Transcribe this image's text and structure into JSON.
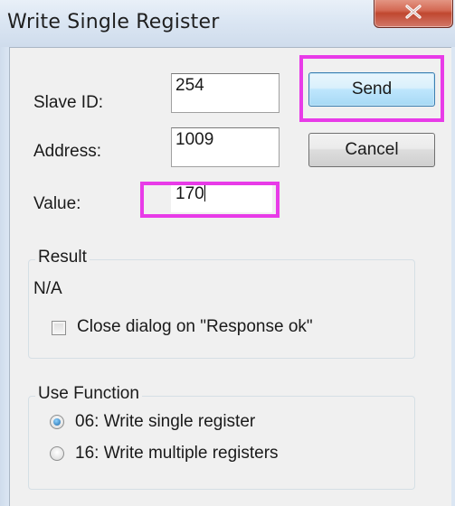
{
  "window": {
    "title": "Write Single Register"
  },
  "form": {
    "slave_id": {
      "label": "Slave ID:",
      "value": "254"
    },
    "address": {
      "label": "Address:",
      "value": "1009"
    },
    "value": {
      "label": "Value:",
      "value": "170"
    }
  },
  "buttons": {
    "send_label": "Send",
    "cancel_label": "Cancel"
  },
  "result": {
    "title": "Result",
    "text": "N/A",
    "checkbox_label": "Close dialog on \"Response ok\"",
    "checkbox_checked": false
  },
  "use_function": {
    "title": "Use Function",
    "options": [
      {
        "label": "06: Write single register",
        "selected": true
      },
      {
        "label": "16: Write multiple registers",
        "selected": false
      }
    ]
  },
  "colors": {
    "highlight": "#e83be8",
    "window_bg": "#f0f0f0",
    "title_bar": "#dbe6f3",
    "close_button": "#c0472f"
  },
  "icons": {
    "close": "close-icon"
  }
}
